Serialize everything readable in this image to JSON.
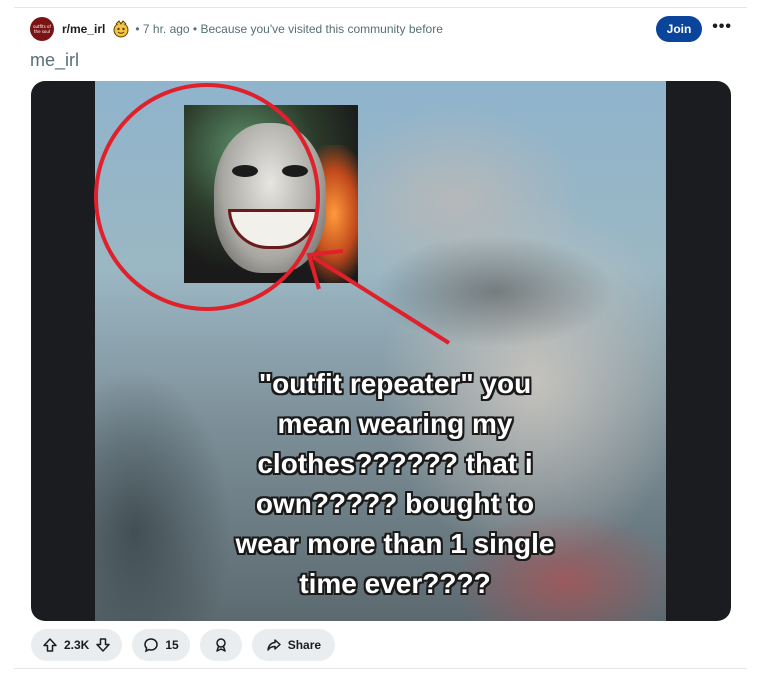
{
  "header": {
    "avatar_text": "outfits of the soul",
    "subreddit": "r/me_irl",
    "meta": "• 7 hr. ago • Because you've visited this community before",
    "join_label": "Join",
    "more_label": "•••"
  },
  "post": {
    "title": "me_irl",
    "overlay_lines": [
      "\"outfit repeater\" you",
      "mean wearing my",
      "clothes?????? that i",
      "own????? bought to",
      "wear more than 1 single",
      "time ever????"
    ]
  },
  "actions": {
    "upvotes": "2.3K",
    "comments": "15",
    "share_label": "Share"
  },
  "colors": {
    "join_bg": "#0a449b",
    "pill_bg": "#eaedef",
    "annotation_red": "#e0202a",
    "meta_gray": "#576f76"
  },
  "icons": [
    "upvote-icon",
    "downvote-icon",
    "comment-icon",
    "award-icon",
    "share-icon",
    "more-icon"
  ]
}
